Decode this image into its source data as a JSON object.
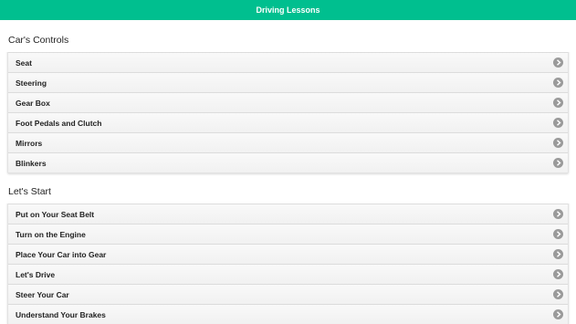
{
  "header": {
    "title": "Driving Lessons"
  },
  "sections": [
    {
      "title": "Car's Controls",
      "items": [
        "Seat",
        "Steering",
        "Gear Box",
        "Foot Pedals and Clutch",
        "Mirrors",
        "Blinkers"
      ]
    },
    {
      "title": "Let's Start",
      "items": [
        "Put on Your Seat Belt",
        "Turn on the Engine",
        "Place Your Car into Gear",
        "Let's Drive",
        "Steer Your Car",
        "Understand Your Brakes"
      ]
    }
  ],
  "colors": {
    "header_bg": "#00bf8f",
    "chevron_bg": "#9a9a9a"
  },
  "icons": {
    "list_item": "chevron-right-circle-icon"
  }
}
